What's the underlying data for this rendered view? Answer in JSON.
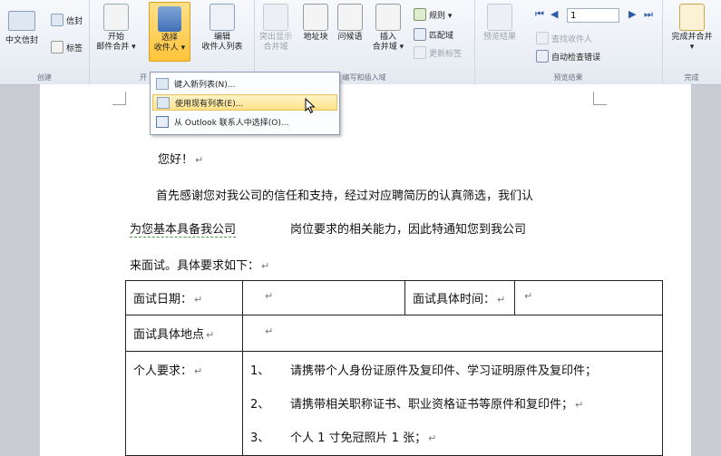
{
  "ribbon": {
    "groups": {
      "create": "创建",
      "start_merge": "开",
      "write_insert": "编写和插入域",
      "preview": "预览结果",
      "finish": "完成"
    },
    "create_group": {
      "chinese_envelope": "中文信封",
      "envelope": "信封",
      "labels": "标签"
    },
    "start_group": {
      "start_merge_line1": "开始",
      "start_merge_line2": "邮件合并 ▾",
      "select_recipients_line1": "选择",
      "select_recipients_line2": "收件人 ▾",
      "edit_recipients_line1": "编辑",
      "edit_recipients_line2": "收件人列表"
    },
    "write_group": {
      "highlight_fields_line1": "突出显示",
      "highlight_fields_line2": "合并域",
      "address_block": "地址块",
      "greeting_line": "问候语",
      "insert_merge_field_line1": "插入",
      "insert_merge_field_line2": "合并域 ▾",
      "rules": "规则 ▾",
      "match_fields": "匹配域",
      "update_labels": "更新标签"
    },
    "preview_group": {
      "preview_results": "预览结果",
      "record_number": "1",
      "find_recipient": "查找收件人",
      "auto_check_errors": "自动检查错误"
    },
    "finish_group": {
      "finish_merge_line1": "完成并合并",
      "finish_merge_line2": "▾"
    }
  },
  "dropdown": {
    "items": [
      {
        "label": "键入新列表(N)...",
        "highlighted": false
      },
      {
        "label": "使用现有列表(E)...",
        "highlighted": true
      },
      {
        "label": "从 Outlook 联系人中选择(O)...",
        "highlighted": false
      }
    ]
  },
  "document": {
    "greeting": "您好！",
    "line1": "首先感谢您对我公司的信任和支持，经过对应聘简历的认真筛选，我们认",
    "line2_a": "为您基本具备我公司",
    "line2_b": "岗位要求的相关能力，因此特通知您到我公司",
    "line3": "来面试。具体要求如下：",
    "para_mark": "↵",
    "table": {
      "interview_date_label": "面试日期：",
      "interview_time_label": "面试具体时间：",
      "interview_location_label": "面试具体地点",
      "personal_requirements_label": "个人要求：",
      "requirements": [
        {
          "num": "1、",
          "text": "请携带个人身份证原件及复印件、学习证明原件及复印件；"
        },
        {
          "num": "2、",
          "text": "请携带相关职称证书、职业资格证书等原件和复印件；"
        },
        {
          "num": "3、",
          "text": "个人 1 寸免冠照片 1 张；"
        }
      ]
    }
  }
}
